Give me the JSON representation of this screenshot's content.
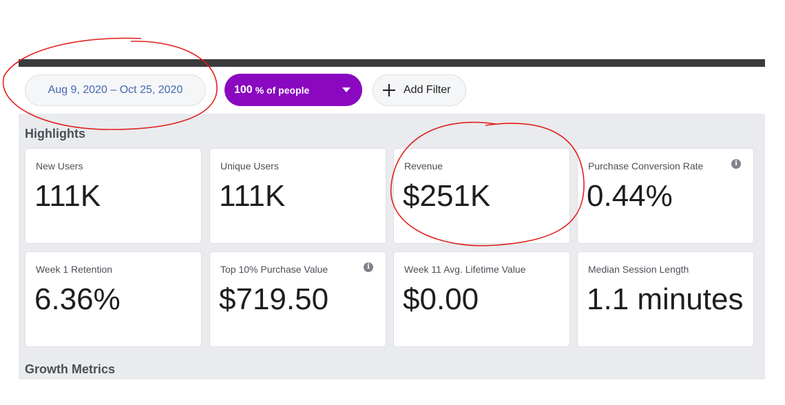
{
  "toolbar": {
    "date_range": "Aug 9, 2020 – Oct 25, 2020",
    "people_percent": "100",
    "people_suffix": "% of people",
    "add_filter_label": "Add Filter"
  },
  "sections": {
    "highlights": "Highlights",
    "growth_metrics": "Growth Metrics"
  },
  "cards": [
    {
      "label": "New Users",
      "value": "111K",
      "info": false
    },
    {
      "label": "Unique Users",
      "value": "111K",
      "info": false
    },
    {
      "label": "Revenue",
      "value": "$251K",
      "info": false
    },
    {
      "label": "Purchase Conversion Rate",
      "value": "0.44%",
      "info": true
    },
    {
      "label": "Week 1 Retention",
      "value": "6.36%",
      "info": false
    },
    {
      "label": "Top 10% Purchase Value",
      "value": "$719.50",
      "info": true
    },
    {
      "label": "Week 11 Avg. Lifetime Value",
      "value": "$0.00",
      "info": false
    },
    {
      "label": "Median Session Length",
      "value": "1.1 minutes",
      "info": false
    }
  ],
  "icons": {
    "info": "info-icon",
    "plus": "plus-icon",
    "caret": "chevron-down-icon"
  },
  "colors": {
    "accent_purple": "#8a08bf",
    "link_blue": "#4267b2",
    "annotation_red": "#e0211b",
    "panel_bg": "#e9ebee"
  }
}
